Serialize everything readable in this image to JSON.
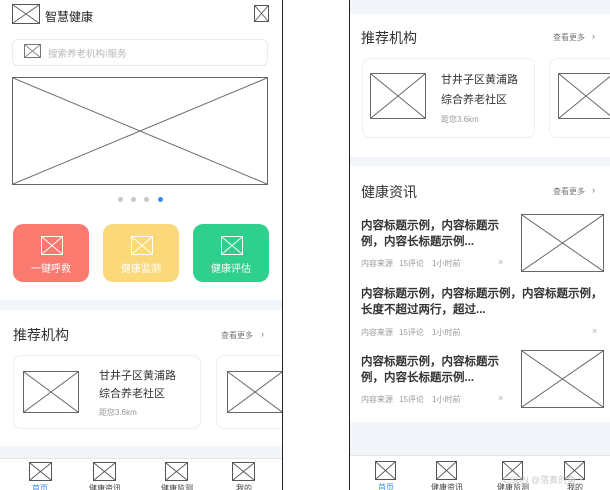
{
  "app": {
    "title": "智慧健康"
  },
  "search": {
    "placeholder": "搜索养老机构/服务"
  },
  "banner": {
    "dots": 4,
    "active_dot": 4
  },
  "quick_actions": [
    {
      "label": "一键呼救",
      "color": "#fb7a70"
    },
    {
      "label": "健康监测",
      "color": "#fbd97a"
    },
    {
      "label": "健康评估",
      "color": "#2fcf8e"
    }
  ],
  "institutions": {
    "title": "推荐机构",
    "more": "查看更多",
    "items": [
      {
        "name": "甘井子区黄浦路",
        "name2": "综合养老社区",
        "distance": "距您3.6km"
      }
    ]
  },
  "news": {
    "title": "健康资讯",
    "more": "查看更多",
    "items": [
      {
        "title": "内容标题示例，内容标题示例，内容长标题示例...",
        "source": "内容来源",
        "comments": "15评论",
        "time": "1小时前"
      },
      {
        "title": "内容标题示例，内容标题示例，内容标题示例，长度不超过两行，超过...",
        "source": "内容来源",
        "comments": "15评论",
        "time": "1小时前"
      },
      {
        "title": "内容标题示例，内容标题示例，内容长标题示例...",
        "source": "内容来源",
        "comments": "15评论",
        "time": "1小时前"
      }
    ],
    "dismiss": "×"
  },
  "tabbar": {
    "items": [
      {
        "label": "首页",
        "active": true
      },
      {
        "label": "健康资讯",
        "active": false
      },
      {
        "label": "健康监测",
        "active": false
      },
      {
        "label": "我的",
        "active": false
      }
    ]
  },
  "watermark": "CSDN @落寞的鱼丶"
}
